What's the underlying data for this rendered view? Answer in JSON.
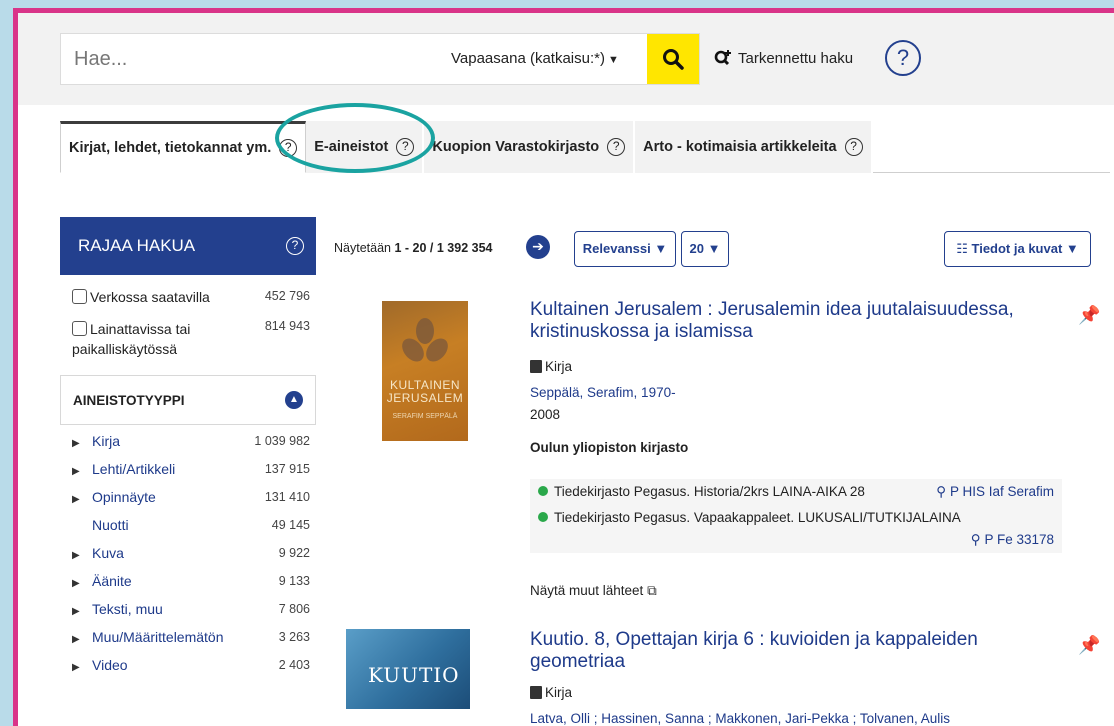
{
  "search": {
    "placeholder": "Hae...",
    "type_label": "Vapaasana (katkaisu:*)",
    "advanced_label": "Tarkennettu haku"
  },
  "tabs": [
    {
      "label": "Kirjat, lehdet, tietokannat ym."
    },
    {
      "label": "E-aineistot"
    },
    {
      "label": "Kuopion Varastokirjasto"
    },
    {
      "label": "Arto - kotimaisia artikkeleita"
    }
  ],
  "sidebar": {
    "title": "RAJAA HAKUA",
    "filters": [
      {
        "label": "Verkossa saatavilla",
        "count": "452 796"
      },
      {
        "label": "Lainattavissa tai paikalliskäytössä",
        "count": "814 943"
      }
    ],
    "facet_title": "AINEISTOTYYPPI",
    "facets": [
      {
        "label": "Kirja",
        "count": "1 039 982",
        "expandable": true
      },
      {
        "label": "Lehti/Artikkeli",
        "count": "137 915",
        "expandable": true
      },
      {
        "label": "Opinnäyte",
        "count": "131 410",
        "expandable": true
      },
      {
        "label": "Nuotti",
        "count": "49 145",
        "expandable": false
      },
      {
        "label": "Kuva",
        "count": "9 922",
        "expandable": true
      },
      {
        "label": "Äänite",
        "count": "9 133",
        "expandable": true
      },
      {
        "label": "Teksti, muu",
        "count": "7 806",
        "expandable": true
      },
      {
        "label": "Muu/Määrittelemätön",
        "count": "3 263",
        "expandable": true
      },
      {
        "label": "Video",
        "count": "2 403",
        "expandable": true
      }
    ]
  },
  "results": {
    "prefix": "Näytetään ",
    "range": "1 - 20",
    "separator": " / ",
    "total": "1 392 354",
    "sort_label": "Relevanssi ▼",
    "limit_label": "20 ▼",
    "view_label": "Tiedot ja kuvat ▼",
    "records": [
      {
        "title": "Kultainen Jerusalem : Jerusalemin idea juutalaisuudessa, kristinuskossa ja islamissa",
        "format": "Kirja",
        "author": "Seppälä, Serafim, 1970-",
        "year": "2008",
        "library": "Oulun yliopiston kirjasto",
        "cover_title": "KULTAINEN JERUSALEM",
        "cover_author": "SERAFIM SEPPÄLÄ",
        "holdings": [
          {
            "text": "Tiedekirjasto Pegasus. Historia/2krs LAINA-AIKA 28",
            "callno": "P HIS Iaf Serafim"
          },
          {
            "text": "Tiedekirjasto Pegasus. Vapaakappaleet. LUKUSALI/TUTKIJALAINA",
            "callno": "P Fe 33178"
          }
        ],
        "show_more": "Näytä muut lähteet"
      },
      {
        "title": "Kuutio. 8, Opettajan kirja 6 : kuvioiden ja kappaleiden geometriaa",
        "format": "Kirja",
        "author": "Latva, Olli ; Hassinen, Sanna ; Makkonen, Jari-Pekka ; Tolvanen, Aulis",
        "cover_title": "KUUTIO"
      }
    ]
  },
  "colors": {
    "frame": "#d93489",
    "brand_blue": "#23408e",
    "search_button": "#ffe600",
    "highlight_circle": "#1aa3a1",
    "available_dot": "#2aa84a"
  }
}
